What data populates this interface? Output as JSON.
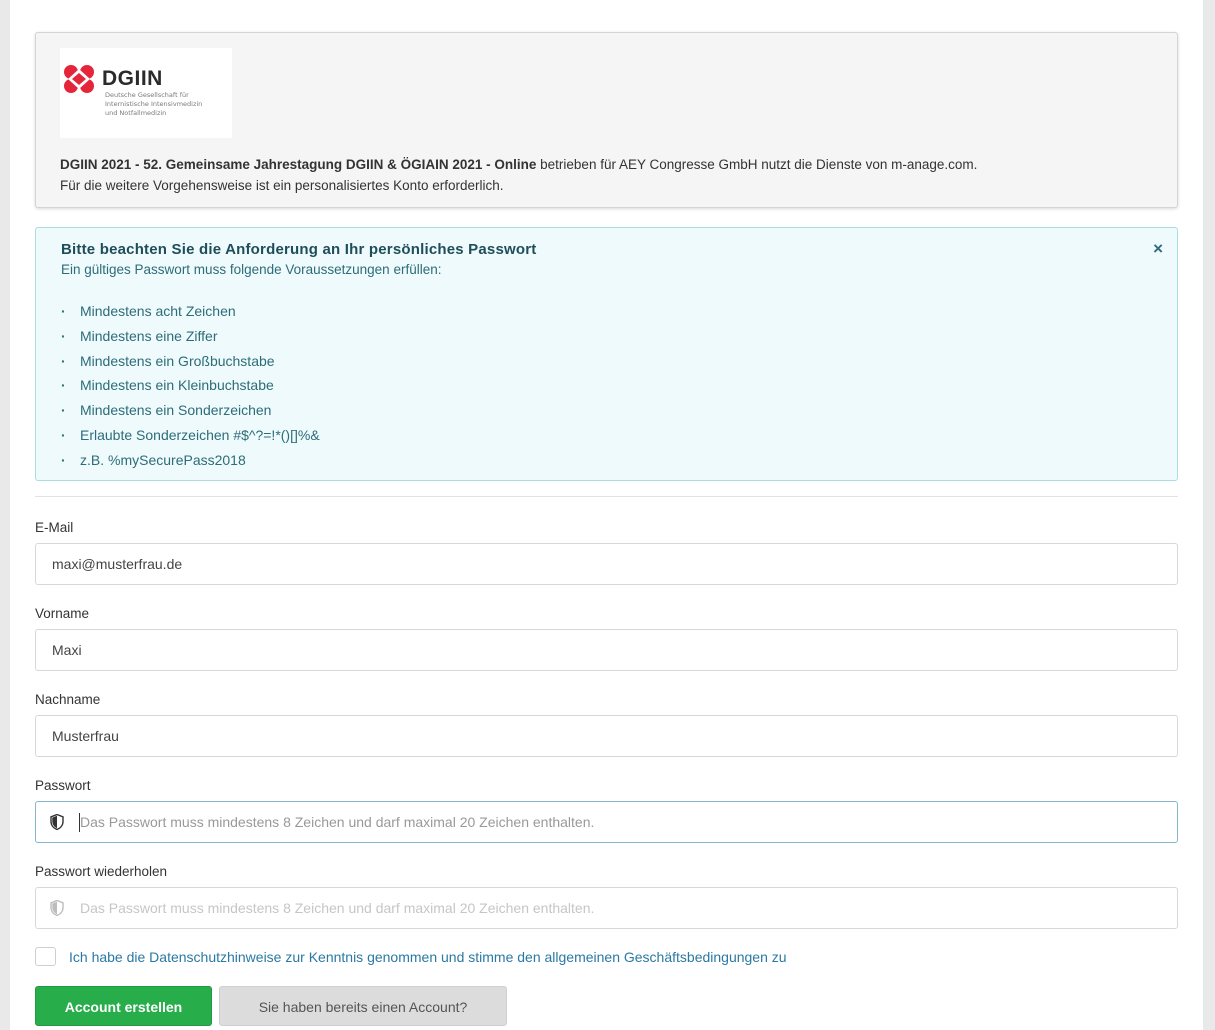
{
  "org": {
    "logo": {
      "name": "DGIIN",
      "subtitle": "Deutsche Gesellschaft für\nInternistische Intensivmedizin\nund Notfallmedizin"
    },
    "congress_name": "DGIIN 2021 - 52. Gemeinsame Jahrestagung DGIIN & ÖGIAIN 2021 - Online",
    "intro_rest": " betrieben für AEY Congresse GmbH nutzt die Dienste von m-anage.com.",
    "intro_line2": "Für die weitere Vorgehensweise ist ein personalisiertes Konto erforderlich."
  },
  "password_info": {
    "title": "Bitte beachten Sie die Anforderung an Ihr persönliches Passwort",
    "subtitle": "Ein gültiges Passwort muss folgende Voraussetzungen erfüllen:",
    "close_icon": "×",
    "requirements": [
      "Mindestens acht Zeichen",
      "Mindestens eine Ziffer",
      "Mindestens ein Großbuchstabe",
      "Mindestens ein Kleinbuchstabe",
      "Mindestens ein Sonderzeichen",
      "Erlaubte Sonderzeichen #$^?=!*()[]%&",
      "z.B. %mySecurePass2018"
    ]
  },
  "form": {
    "email": {
      "label": "E-Mail",
      "value": "maxi@musterfrau.de"
    },
    "firstname": {
      "label": "Vorname",
      "value": "Maxi"
    },
    "lastname": {
      "label": "Nachname",
      "value": "Musterfrau"
    },
    "password": {
      "label": "Passwort",
      "placeholder": "Das Passwort muss mindestens 8 Zeichen und darf maximal 20 Zeichen enthalten."
    },
    "password_repeat": {
      "label": "Passwort wiederholen",
      "placeholder": "Das Passwort muss mindestens 8 Zeichen und darf maximal 20 Zeichen enthalten."
    },
    "consent_text": "Ich habe die Datenschutzhinweise zur Kenntnis genommen und stimme den allgemeinen Geschäftsbedingungen zu",
    "create_button": "Account erstellen",
    "login_button": "Sie haben bereits einen Account?"
  },
  "colors": {
    "primary_button": "#27ad4a",
    "info_background": "#eefafb",
    "link": "#2a79a3"
  }
}
